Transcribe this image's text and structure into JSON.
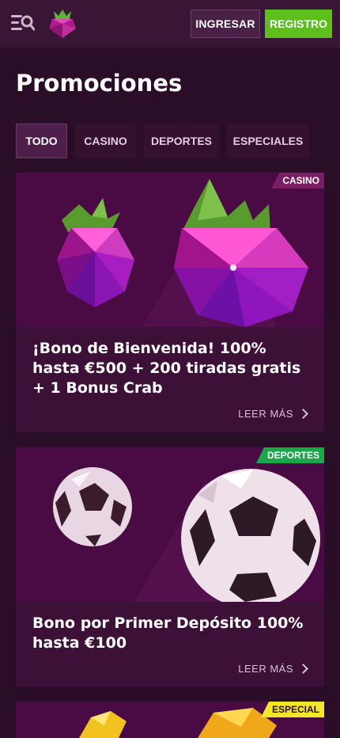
{
  "header": {
    "login_label": "INGRESAR",
    "register_label": "REGISTRO",
    "brand_color": "#5cbf1c",
    "menu_icon": "menu-search-icon",
    "logo_icon": "raspberry-logo"
  },
  "page_title": "Promociones",
  "tabs": [
    {
      "label": "TODO",
      "active": true
    },
    {
      "label": "CASINO",
      "active": false
    },
    {
      "label": "DEPORTES",
      "active": false
    },
    {
      "label": "ESPECIALES",
      "active": false
    }
  ],
  "promos": [
    {
      "badge": "CASINO",
      "badge_color": "#7a1f66",
      "title": "¡Bono de Bienvenida! 100% hasta €500 + 200 tiradas gratis + 1 Bonus Crab",
      "more_label": "LEER MÁS",
      "image": "raspberry-gems"
    },
    {
      "badge": "DEPORTES",
      "badge_color": "#1aa64a",
      "title": "Bono por Primer Depósito 100% hasta €100",
      "more_label": "LEER MÁS",
      "image": "soccer-balls"
    },
    {
      "badge": "ESPECIAL",
      "badge_color": "#f3e72c",
      "image": "gold-gems"
    }
  ]
}
